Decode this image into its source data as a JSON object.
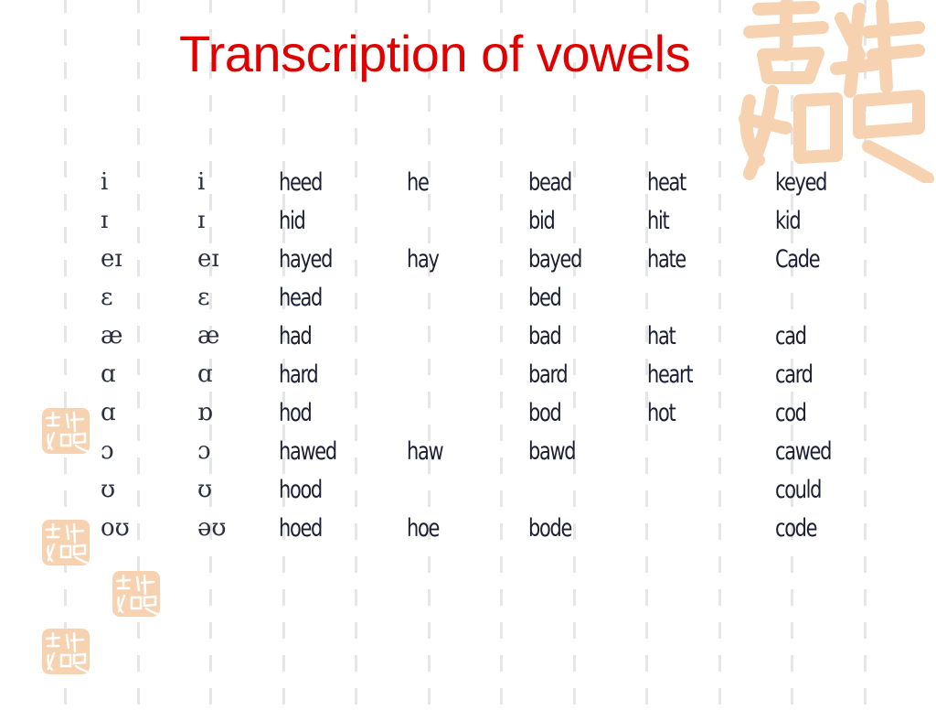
{
  "slide": {
    "title": "Transcription of vowels",
    "title_color": "#e00000",
    "watermark": {
      "seal_text": "吉祥如意",
      "seal_color": "#f7d2b0"
    }
  },
  "table": {
    "rows": [
      [
        "i",
        "i",
        "heed",
        "he",
        "bead",
        "heat",
        "keyed"
      ],
      [
        "ɪ",
        "ɪ",
        "hid",
        "",
        "bid",
        "hit",
        "kid"
      ],
      [
        "eɪ",
        "eɪ",
        "hayed",
        "hay",
        "bayed",
        "hate",
        "Cade"
      ],
      [
        "ɛ",
        "ɛ",
        "head",
        "",
        "bed",
        "",
        ""
      ],
      [
        "æ",
        "æ",
        "had",
        "",
        "bad",
        "hat",
        "cad"
      ],
      [
        "ɑ",
        "ɑ",
        "hard",
        "",
        "bard",
        "heart",
        "card"
      ],
      [
        "ɑ",
        "ɒ",
        "hod",
        "",
        "bod",
        "hot",
        "cod"
      ],
      [
        "ɔ",
        "ɔ",
        "hawed",
        "haw",
        "bawd",
        "",
        "cawed"
      ],
      [
        "ʊ",
        "ʊ",
        "hood",
        "",
        "",
        "",
        "could"
      ],
      [
        "oʊ",
        "əʊ",
        "hoed",
        "hoe",
        "bode",
        "",
        "code"
      ]
    ]
  }
}
